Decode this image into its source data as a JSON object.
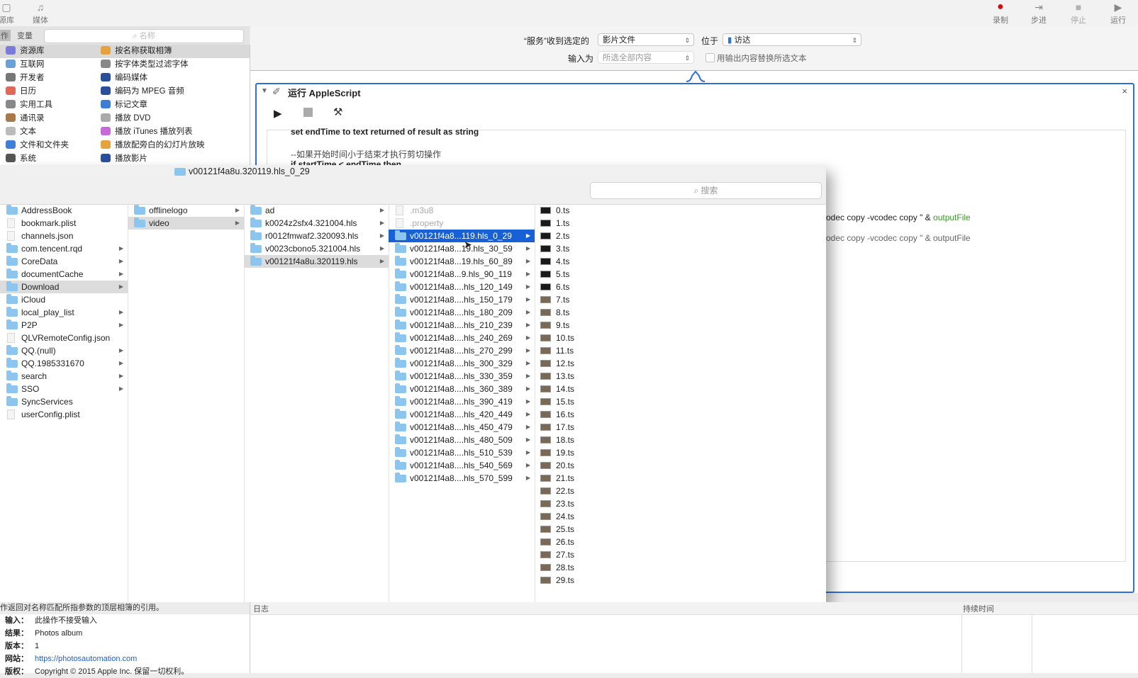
{
  "toolbar": {
    "left": [
      {
        "label": "源库",
        "icon": "library-icon"
      },
      {
        "label": "媒体",
        "icon": "music-note-icon"
      }
    ],
    "right": [
      {
        "label": "录制",
        "icon": "record-icon"
      },
      {
        "label": "步进",
        "icon": "step-icon"
      },
      {
        "label": "停止",
        "icon": "stop-icon"
      },
      {
        "label": "运行",
        "icon": "run-icon"
      }
    ]
  },
  "library": {
    "tab_actions": "作",
    "tab_variables": "变量",
    "search_placeholder": "名称",
    "categories": [
      {
        "label": "资源库",
        "color": "#7b7bd9",
        "selected": true
      },
      {
        "label": "互联网",
        "color": "#6aa0d8"
      },
      {
        "label": "开发者",
        "color": "#777"
      },
      {
        "label": "日历",
        "color": "#e06a5a"
      },
      {
        "label": "实用工具",
        "color": "#888"
      },
      {
        "label": "通讯录",
        "color": "#a67a4a"
      },
      {
        "label": "文本",
        "color": "#bbb"
      },
      {
        "label": "文件和文件夹",
        "color": "#3f7fd6"
      },
      {
        "label": "系统",
        "color": "#555"
      }
    ],
    "actions": [
      {
        "label": "按名称获取相簿",
        "color": "#e6a23c",
        "selected": true
      },
      {
        "label": "按字体类型过滤字体",
        "color": "#888"
      },
      {
        "label": "编码媒体",
        "color": "#2b4f9c"
      },
      {
        "label": "编码为 MPEG 音频",
        "color": "#2b4f9c"
      },
      {
        "label": "标记文章",
        "color": "#3a7fd5"
      },
      {
        "label": "播放 DVD",
        "color": "#aaa"
      },
      {
        "label": "播放 iTunes 播放列表",
        "color": "#c56ad8"
      },
      {
        "label": "播放配旁白的幻灯片放映",
        "color": "#e6a23c"
      },
      {
        "label": "播放影片",
        "color": "#2b4f9c"
      }
    ]
  },
  "workflow": {
    "receive_label": "“服务”收到选定的",
    "receive_value": "影片文件",
    "location_label": "位于",
    "location_value": "访达",
    "input_label": "输入为",
    "input_value": "所选全部内容",
    "replace_label": "用输出内容替换所选文本",
    "action_title": "运行 AppleScript",
    "code_line1": "set endTime to text returned of result as string",
    "code_comment": "--如果开始时间小于结束才执行剪切操作",
    "code_if": "if startTime < endTime then",
    "code_right1_pre": "odec copy -vcodec copy \" & ",
    "code_right1_var": "outputFile",
    "code_right2": "odec copy -vcodec copy \" & outputFile"
  },
  "finder": {
    "title": "v00121f4a8u.320119.hls_0_29",
    "search_placeholder": "搜索",
    "col1": [
      {
        "name": "AddressBook",
        "type": "folder"
      },
      {
        "name": "bookmark.plist",
        "type": "file"
      },
      {
        "name": "channels.json",
        "type": "file"
      },
      {
        "name": "com.tencent.rqd",
        "type": "folder",
        "arrow": true
      },
      {
        "name": "CoreData",
        "type": "folder",
        "arrow": true
      },
      {
        "name": "documentCache",
        "type": "folder",
        "arrow": true
      },
      {
        "name": "Download",
        "type": "folder",
        "arrow": true,
        "state": "gray"
      },
      {
        "name": "iCloud",
        "type": "folder"
      },
      {
        "name": "local_play_list",
        "type": "folder",
        "arrow": true
      },
      {
        "name": "P2P",
        "type": "folder",
        "arrow": true
      },
      {
        "name": "QLVRemoteConfig.json",
        "type": "file"
      },
      {
        "name": "QQ.(null)",
        "type": "folder",
        "arrow": true
      },
      {
        "name": "QQ.1985331670",
        "type": "folder",
        "arrow": true
      },
      {
        "name": "search",
        "type": "folder",
        "arrow": true
      },
      {
        "name": "SSO",
        "type": "folder",
        "arrow": true
      },
      {
        "name": "SyncServices",
        "type": "folder"
      },
      {
        "name": "userConfig.plist",
        "type": "file"
      }
    ],
    "col2": [
      {
        "name": "offlinelogo",
        "type": "folder",
        "arrow": true
      },
      {
        "name": "video",
        "type": "folder",
        "arrow": true,
        "state": "gray"
      }
    ],
    "col3": [
      {
        "name": "ad",
        "type": "folder",
        "arrow": true
      },
      {
        "name": "k0024z2sfx4.321004.hls",
        "type": "folder",
        "arrow": true
      },
      {
        "name": "r0012fmwaf2.320093.hls",
        "type": "folder",
        "arrow": true
      },
      {
        "name": "v0023cbono5.321004.hls",
        "type": "folder",
        "arrow": true
      },
      {
        "name": "v00121f4a8u.320119.hls",
        "type": "folder",
        "arrow": true,
        "state": "gray"
      }
    ],
    "col4": [
      {
        "name": ".m3u8",
        "type": "file",
        "state": "dim"
      },
      {
        "name": ".property",
        "type": "file",
        "state": "dim"
      },
      {
        "name": "v00121f4a8...119.hls_0_29",
        "type": "folder",
        "arrow": true,
        "state": "blue"
      },
      {
        "name": "v00121f4a8...19.hls_30_59",
        "type": "folder",
        "arrow": true
      },
      {
        "name": "v00121f4a8...19.hls_60_89",
        "type": "folder",
        "arrow": true
      },
      {
        "name": "v00121f4a8...9.hls_90_119",
        "type": "folder",
        "arrow": true
      },
      {
        "name": "v00121f4a8....hls_120_149",
        "type": "folder",
        "arrow": true
      },
      {
        "name": "v00121f4a8....hls_150_179",
        "type": "folder",
        "arrow": true
      },
      {
        "name": "v00121f4a8....hls_180_209",
        "type": "folder",
        "arrow": true
      },
      {
        "name": "v00121f4a8....hls_210_239",
        "type": "folder",
        "arrow": true
      },
      {
        "name": "v00121f4a8....hls_240_269",
        "type": "folder",
        "arrow": true
      },
      {
        "name": "v00121f4a8....hls_270_299",
        "type": "folder",
        "arrow": true
      },
      {
        "name": "v00121f4a8....hls_300_329",
        "type": "folder",
        "arrow": true
      },
      {
        "name": "v00121f4a8....hls_330_359",
        "type": "folder",
        "arrow": true
      },
      {
        "name": "v00121f4a8....hls_360_389",
        "type": "folder",
        "arrow": true
      },
      {
        "name": "v00121f4a8....hls_390_419",
        "type": "folder",
        "arrow": true
      },
      {
        "name": "v00121f4a8....hls_420_449",
        "type": "folder",
        "arrow": true
      },
      {
        "name": "v00121f4a8....hls_450_479",
        "type": "folder",
        "arrow": true
      },
      {
        "name": "v00121f4a8....hls_480_509",
        "type": "folder",
        "arrow": true
      },
      {
        "name": "v00121f4a8....hls_510_539",
        "type": "folder",
        "arrow": true
      },
      {
        "name": "v00121f4a8....hls_540_569",
        "type": "folder",
        "arrow": true
      },
      {
        "name": "v00121f4a8....hls_570_599",
        "type": "folder",
        "arrow": true
      }
    ],
    "col5": [
      "0.ts",
      "1.ts",
      "2.ts",
      "3.ts",
      "4.ts",
      "5.ts",
      "6.ts",
      "7.ts",
      "8.ts",
      "9.ts",
      "10.ts",
      "11.ts",
      "12.ts",
      "13.ts",
      "14.ts",
      "15.ts",
      "16.ts",
      "17.ts",
      "18.ts",
      "19.ts",
      "20.ts",
      "21.ts",
      "22.ts",
      "23.ts",
      "24.ts",
      "25.ts",
      "26.ts",
      "27.ts",
      "28.ts",
      "29.ts"
    ]
  },
  "description": {
    "summary": "作返回对名称匹配所指参数的顶层相簿的引用。",
    "input_label": "输入：",
    "input_value": "此操作不接受输入",
    "result_label": "结果：",
    "result_value": "Photos album",
    "version_label": "版本：",
    "version_value": "1",
    "website_label": "网站：",
    "website_value": "https://photosautomation.com",
    "copyright_label": "版权：",
    "copyright_value": "Copyright © 2015 Apple Inc. 保留一切权利。"
  },
  "log": {
    "log_label": "日志",
    "duration_label": "持续时间"
  },
  "colors": {
    "accent": "#1760d6",
    "action_border": "#2f6fd8",
    "keyword_green": "#3a9a2a",
    "keyword_purple": "#6a3aa8"
  }
}
